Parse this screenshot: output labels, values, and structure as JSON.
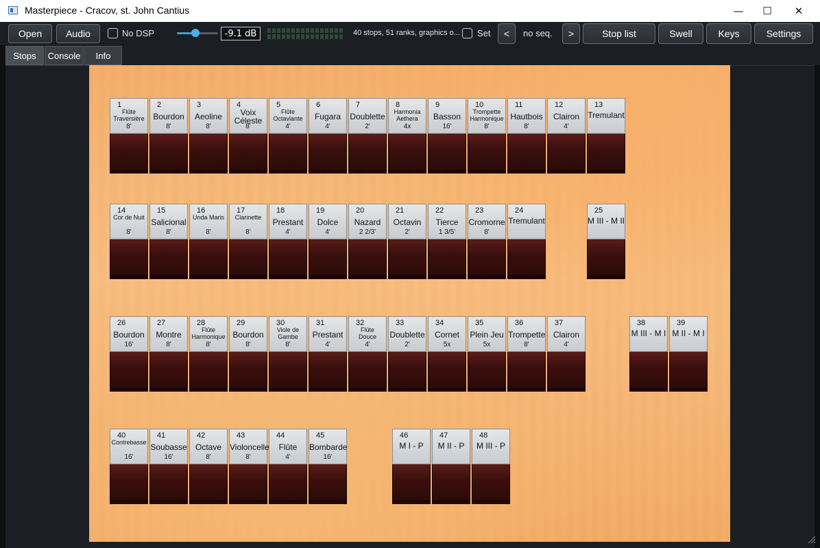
{
  "window": {
    "title": "Masterpiece - Cracov, st. John Cantius",
    "minimize": "—",
    "maximize": "☐",
    "close": "✕"
  },
  "toolbar": {
    "open_label": "Open",
    "audio_label": "Audio",
    "nodsp_label": "No DSP",
    "volume_db": "-9.1 dB",
    "volume_level": 0.45,
    "info_text": "40 stops, 51 ranks, graphics o...",
    "set_label": "Set",
    "prev_label": "<",
    "seq_label": "no seq.",
    "next_label": ">",
    "stoplist_label": "Stop list",
    "swell_label": "Swell",
    "keys_label": "Keys",
    "settings_label": "Settings"
  },
  "tabs": [
    {
      "label": "Stops"
    },
    {
      "label": "Console"
    },
    {
      "label": "Info"
    }
  ],
  "stops": [
    {
      "n": "1",
      "name": "Flûte\nTraversière",
      "foot": "8'",
      "small": true
    },
    {
      "n": "2",
      "name": "Bourdon",
      "foot": "8'"
    },
    {
      "n": "3",
      "name": "Aeoline",
      "foot": "8'"
    },
    {
      "n": "4",
      "name": "Voix\nCéleste",
      "foot": "8'"
    },
    {
      "n": "5",
      "name": "Flûte\nOctaviante",
      "foot": "4'",
      "small": true
    },
    {
      "n": "6",
      "name": "Fugara",
      "foot": "4'"
    },
    {
      "n": "7",
      "name": "Doublette",
      "foot": "2'"
    },
    {
      "n": "8",
      "name": "Harmonia\nAethera",
      "foot": "4x",
      "small": true
    },
    {
      "n": "9",
      "name": "Basson",
      "foot": "16'"
    },
    {
      "n": "10",
      "name": "Trompette\nHarmonique",
      "foot": "8'",
      "small": true
    },
    {
      "n": "11",
      "name": "Hautbois",
      "foot": "8'"
    },
    {
      "n": "12",
      "name": "Clairon",
      "foot": "4'"
    },
    {
      "n": "13",
      "name": "Tremulant",
      "foot": ""
    },
    {
      "n": "14",
      "name": "Cor de Nuit",
      "foot": "8'",
      "small": true
    },
    {
      "n": "15",
      "name": "Salicional",
      "foot": "8'"
    },
    {
      "n": "16",
      "name": "Unda Maris",
      "foot": "8'",
      "small": true
    },
    {
      "n": "17",
      "name": "Clarinette",
      "foot": "8'",
      "small": true
    },
    {
      "n": "18",
      "name": "Prestant",
      "foot": "4'"
    },
    {
      "n": "19",
      "name": "Dolce",
      "foot": "4'"
    },
    {
      "n": "20",
      "name": "Nazard",
      "foot": "2 2/3'"
    },
    {
      "n": "21",
      "name": "Octavin",
      "foot": "2'"
    },
    {
      "n": "22",
      "name": "Tierce",
      "foot": "1 3/5'"
    },
    {
      "n": "23",
      "name": "Cromorne",
      "foot": "8'"
    },
    {
      "n": "24",
      "name": "Tremulant",
      "foot": ""
    },
    {
      "n": "25",
      "name": "M III - M II",
      "foot": ""
    },
    {
      "n": "26",
      "name": "Bourdon",
      "foot": "16'"
    },
    {
      "n": "27",
      "name": "Montre",
      "foot": "8'"
    },
    {
      "n": "28",
      "name": "Flûte\nHarmonique",
      "foot": "8'",
      "small": true
    },
    {
      "n": "29",
      "name": "Bourdon",
      "foot": "8'"
    },
    {
      "n": "30",
      "name": "Viole de Gambe",
      "foot": "8'",
      "small": true
    },
    {
      "n": "31",
      "name": "Prestant",
      "foot": "4'"
    },
    {
      "n": "32",
      "name": "Flûte\nDouce",
      "foot": "4'",
      "small": true
    },
    {
      "n": "33",
      "name": "Doublette",
      "foot": "2'"
    },
    {
      "n": "34",
      "name": "Cornet",
      "foot": "5x"
    },
    {
      "n": "35",
      "name": "Plein Jeu",
      "foot": "5x"
    },
    {
      "n": "36",
      "name": "Trompette",
      "foot": "8'"
    },
    {
      "n": "37",
      "name": "Clairon",
      "foot": "4'"
    },
    {
      "n": "38",
      "name": "M III - M I",
      "foot": ""
    },
    {
      "n": "39",
      "name": "M II - M I",
      "foot": ""
    },
    {
      "n": "40",
      "name": "Contrebasse",
      "foot": "16'",
      "small": true
    },
    {
      "n": "41",
      "name": "Soubasse",
      "foot": "16'"
    },
    {
      "n": "42",
      "name": "Octave",
      "foot": "8'"
    },
    {
      "n": "43",
      "name": "Violoncelle",
      "foot": "8'"
    },
    {
      "n": "44",
      "name": "Flûte",
      "foot": "4'"
    },
    {
      "n": "45",
      "name": "Bombarde",
      "foot": "16'"
    },
    {
      "n": "46",
      "name": "M I - P",
      "foot": ""
    },
    {
      "n": "47",
      "name": "M II - P",
      "foot": ""
    },
    {
      "n": "48",
      "name": "M III - P",
      "foot": ""
    }
  ]
}
